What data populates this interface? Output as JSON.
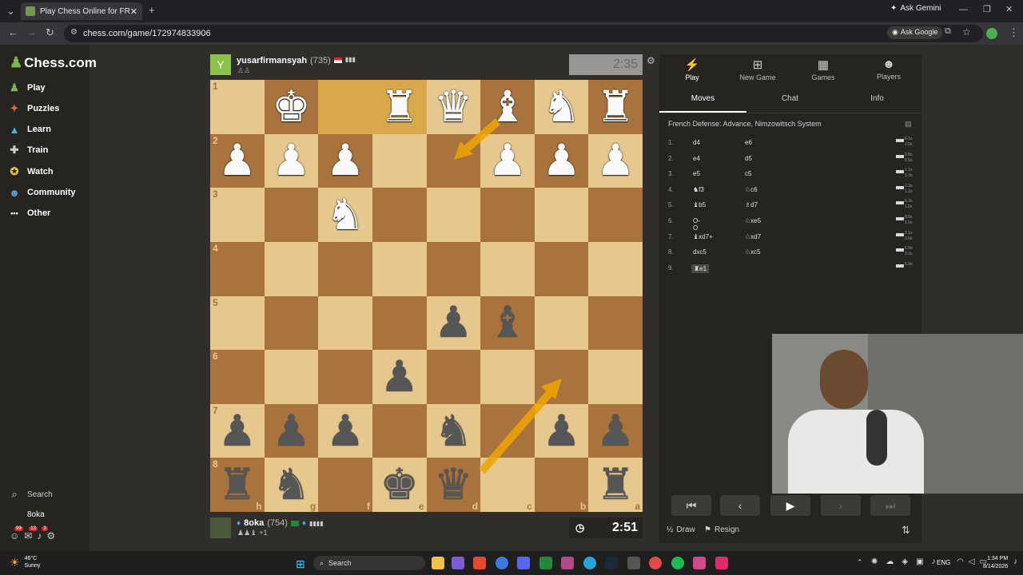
{
  "browser": {
    "tab_title": "Play Chess Online for FREE - 2 Pla...",
    "url": "chess.com/game/172974833906",
    "gemini_label": "Ask Gemini",
    "google_label": "Ask Google"
  },
  "sidebar": {
    "logo": "Chess.com",
    "items": [
      {
        "label": "Play",
        "icon": "♟"
      },
      {
        "label": "Puzzles",
        "icon": "✦"
      },
      {
        "label": "Learn",
        "icon": "▲"
      },
      {
        "label": "Train",
        "icon": "✚"
      },
      {
        "label": "Watch",
        "icon": "✪"
      },
      {
        "label": "Community",
        "icon": "☻"
      },
      {
        "label": "Other",
        "icon": "•••"
      }
    ],
    "search_label": "Search",
    "user_name": "8oka",
    "badges": [
      "99",
      "13",
      "3"
    ]
  },
  "top_player": {
    "avatar_letter": "Y",
    "name": "yusarfirmansyah",
    "rating": "(735)",
    "clock": "2:35"
  },
  "bottom_player": {
    "name": "8oka",
    "rating": "(754)",
    "material": "+1",
    "clock": "2:51"
  },
  "board": {
    "ranks": [
      "1",
      "2",
      "3",
      "4",
      "5",
      "6",
      "7",
      "8"
    ],
    "files": [
      "h",
      "g",
      "f",
      "e",
      "d",
      "c",
      "b",
      "a"
    ],
    "rows": [
      [
        "",
        "wK",
        "",
        "wR",
        "wQ",
        "wB",
        "wN",
        "wR"
      ],
      [
        "wP",
        "wP",
        "wP",
        "",
        "",
        "wP",
        "wP",
        "wP"
      ],
      [
        "",
        "",
        "wN",
        "",
        "",
        "",
        "",
        ""
      ],
      [
        "",
        "",
        "",
        "",
        "",
        "",
        "",
        ""
      ],
      [
        "",
        "",
        "",
        "",
        "bP",
        "bB",
        "",
        ""
      ],
      [
        "",
        "",
        "",
        "bP",
        "",
        "",
        "",
        ""
      ],
      [
        "bP",
        "bP",
        "bP",
        "",
        "bN",
        "",
        "bP",
        "bP"
      ],
      [
        "bR",
        "bN",
        "",
        "bK",
        "bQ",
        "",
        "",
        "bR"
      ]
    ]
  },
  "panel": {
    "tabs": [
      "Play",
      "New Game",
      "Games",
      "Players"
    ],
    "tab_icons": [
      "⚡",
      "⊞",
      "▦",
      "☻"
    ],
    "subtabs": [
      "Moves",
      "Chat",
      "Info"
    ],
    "opening": "French Defense: Advance, Nimzowitsch System",
    "moves": [
      {
        "n": "1.",
        "w": "d4",
        "b": "e6",
        "tw": "6.1s",
        "tb": "2.0s"
      },
      {
        "n": "2.",
        "w": "e4",
        "b": "d5",
        "tw": "2.8s",
        "tb": "0.5s"
      },
      {
        "n": "3.",
        "w": "e5",
        "b": "c5",
        "tw": "1.1s",
        "tb": "1.3s"
      },
      {
        "n": "4.",
        "w": "♞f3",
        "b": "♘c6",
        "tw": "2.3s",
        "tb": "1.2s"
      },
      {
        "n": "5.",
        "w": "♝b5",
        "b": "♗d7",
        "tw": "6.3s",
        "tb": "1.0s"
      },
      {
        "n": "6.",
        "w": "O-O",
        "b": "♘xe5",
        "tw": "8.0s",
        "tb": "1.6s"
      },
      {
        "n": "7.",
        "w": "♝xd7+",
        "b": "♘xd7",
        "tw": "2.1s",
        "tb": "2.6s"
      },
      {
        "n": "8.",
        "w": "dxc5",
        "b": "♘xc5",
        "tw": "6.9s",
        "tb": "3.3s"
      },
      {
        "n": "9.",
        "w": "♜e1",
        "b": "",
        "tw": "5.9s",
        "tb": ""
      }
    ],
    "draw_label": "Draw",
    "resign_label": "Resign"
  },
  "taskbar": {
    "weather_temp": "46°C",
    "weather_desc": "Sunny",
    "search_label": "Search",
    "lang": "ENG",
    "time": "1:34 PM",
    "date": "8/14/2026"
  }
}
